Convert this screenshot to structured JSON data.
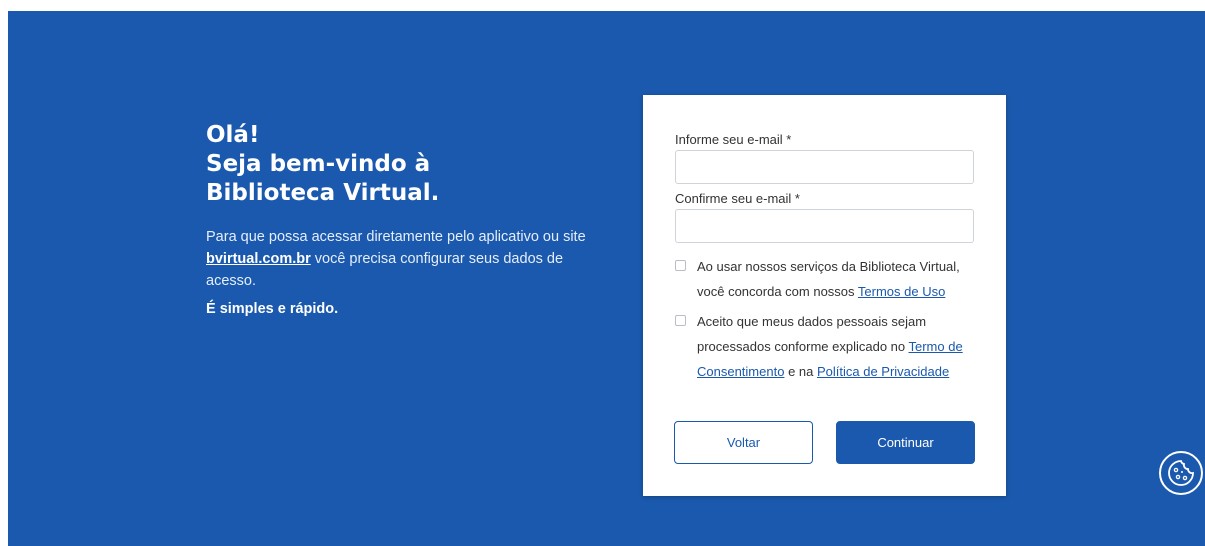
{
  "welcome": {
    "heading_line1": "Olá!",
    "heading_line2": "Seja bem-vindo à",
    "heading_line3": "Biblioteca Virtual.",
    "desc_before": "Para que possa acessar diretamente pelo aplicativo ou site ",
    "desc_link": "bvirtual.com.br",
    "desc_after": " você precisa configurar seus dados de acesso.",
    "tagline": "É simples e rápido."
  },
  "form": {
    "email_label": "Informe seu e-mail *",
    "email_value": "",
    "confirm_label": "Confirme seu e-mail *",
    "confirm_value": "",
    "terms_text": "Ao usar nossos serviços da Biblioteca Virtual, você concorda com nossos ",
    "terms_link": "Termos de Uso",
    "consent_text": "Aceito que meus dados pessoais sejam processados conforme explicado no ",
    "consent_link": "Termo de Consentimento",
    "consent_mid": " e na ",
    "privacy_link": "Política de Privacidade",
    "back_label": "Voltar",
    "continue_label": "Continuar"
  },
  "colors": {
    "brand_blue": "#1a59ad",
    "card_bg": "#ffffff"
  },
  "icons": {
    "cookie": "cookie-icon"
  }
}
